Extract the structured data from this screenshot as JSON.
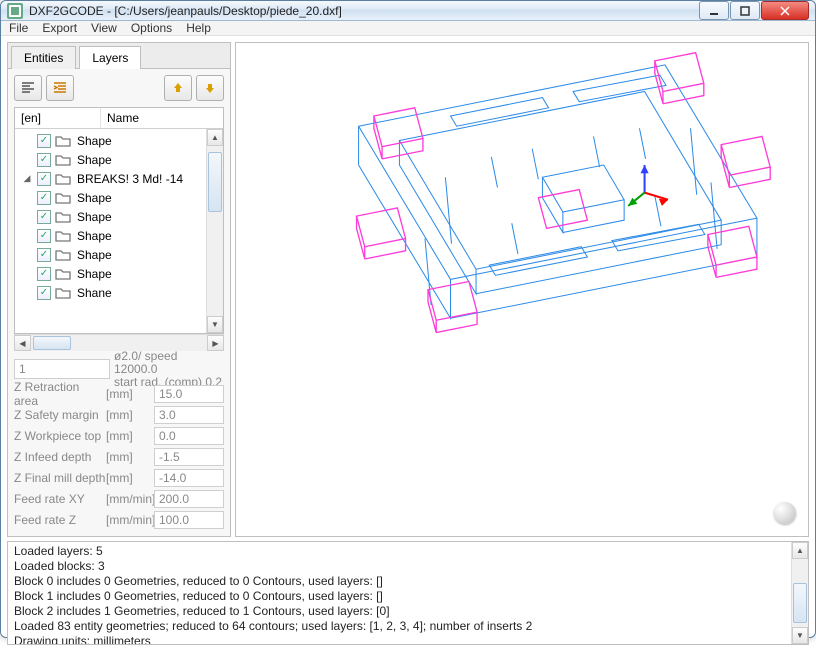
{
  "window": {
    "title": "DXF2GCODE - [C:/Users/jeanpauls/Desktop/piede_20.dxf]"
  },
  "menu": {
    "file": "File",
    "export": "Export",
    "view": "View",
    "options": "Options",
    "help": "Help"
  },
  "tabs": {
    "entities": "Entities",
    "layers": "Layers"
  },
  "tree": {
    "header_en": "[en]",
    "header_name": "Name",
    "items": [
      {
        "caret": "",
        "checked": true,
        "label": "Shape"
      },
      {
        "caret": "",
        "checked": true,
        "label": "Shape"
      },
      {
        "caret": "◢",
        "checked": true,
        "label": "BREAKS! 3 Md! -14"
      },
      {
        "caret": "",
        "checked": true,
        "label": "Shape"
      },
      {
        "caret": "",
        "checked": true,
        "label": "Shape"
      },
      {
        "caret": "",
        "checked": true,
        "label": "Shape"
      },
      {
        "caret": "",
        "checked": true,
        "label": "Shape"
      },
      {
        "caret": "",
        "checked": true,
        "label": "Shape"
      },
      {
        "caret": "",
        "checked": true,
        "label": "Shane"
      }
    ]
  },
  "top_param": {
    "value": "1",
    "info_line1": "ø2.0/ speed 12000.0",
    "info_line2": "start rad. (comp) 0.2"
  },
  "params": [
    {
      "label": "Z Retraction area",
      "unit": "[mm]",
      "value": "15.0"
    },
    {
      "label": "Z Safety margin",
      "unit": "[mm]",
      "value": "3.0"
    },
    {
      "label": "Z Workpiece top",
      "unit": "[mm]",
      "value": "0.0"
    },
    {
      "label": "Z Infeed depth",
      "unit": "[mm]",
      "value": "-1.5"
    },
    {
      "label": "Z Final mill depth",
      "unit": "[mm]",
      "value": "-14.0"
    },
    {
      "label": "Feed rate XY",
      "unit": "[mm/min]",
      "value": "200.0"
    },
    {
      "label": "Feed rate Z",
      "unit": "[mm/min]",
      "value": "100.0"
    }
  ],
  "log": {
    "lines": [
      "Loaded layers: 5",
      "Loaded blocks: 3",
      "Block 0 includes 0 Geometries, reduced to 0 Contours, used layers: []",
      "Block 1 includes 0 Geometries, reduced to 0 Contours, used layers: []",
      "Block 2 includes 1 Geometries, reduced to 1 Contours, used layers: [0]",
      "Loaded 83 entity geometries; reduced to 64 contours; used layers: [1, 2, 3, 4]; number of inserts 2",
      "Drawing units: millimeters"
    ]
  }
}
